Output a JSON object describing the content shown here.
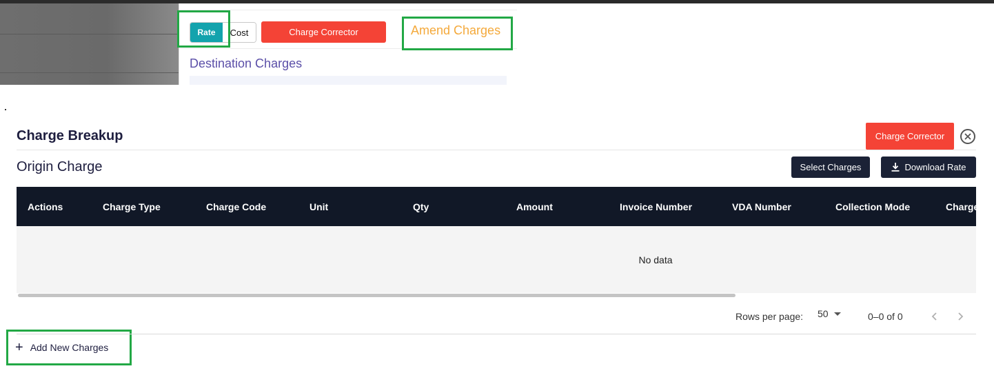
{
  "top": {
    "toggle": {
      "rate_label": "Rate",
      "cost_label": "Cost"
    },
    "charge_corrector_label": "Charge Corrector",
    "amend_charges_label": "Amend Charges",
    "destination_title": "Destination Charges"
  },
  "main": {
    "title": "Charge Breakup",
    "charge_corrector_label": "Charge Corrector",
    "section_title": "Origin Charge",
    "select_charges_label": "Select Charges",
    "download_rate_label": "Download Rate",
    "table": {
      "columns": [
        "Actions",
        "Charge Type",
        "Charge Code",
        "Unit",
        "Qty",
        "Amount",
        "Invoice Number",
        "VDA Number",
        "Collection Mode",
        "Charge"
      ],
      "empty_text": "No data"
    },
    "pagination": {
      "rows_per_page_label": "Rows per page:",
      "rows_per_page_value": "50",
      "range_text": "0–0 of 0"
    },
    "add_new_label": "Add New Charges"
  },
  "colors": {
    "accent_teal": "#13a3ad",
    "danger_red": "#f44336",
    "amend_orange": "#f4a93b",
    "header_dark": "#111827",
    "highlight_green": "#22a845"
  }
}
